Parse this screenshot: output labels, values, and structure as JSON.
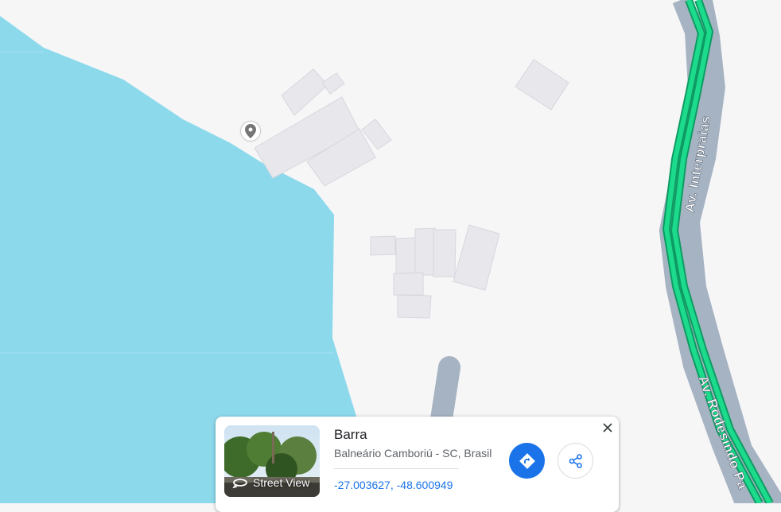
{
  "map": {
    "roads": [
      {
        "name": "Av. Interpraias"
      },
      {
        "name": "Av. Rodesindo Pa"
      }
    ],
    "colors": {
      "water": "#8dd9ec",
      "land": "#f7f6f7",
      "building": "#e8e8ec",
      "building_stroke": "#d5d7de",
      "road_casing": "#a6b3c2",
      "highway": "#1ddb8c",
      "highway_stroke": "#0e9b63"
    }
  },
  "marker": {
    "icon": "place-pin-icon"
  },
  "place_card": {
    "title": "Barra",
    "subtitle": "Balneário Camboriú - SC, Brasil",
    "coordinates": "-27.003627, -48.600949",
    "thumbnail_label": "Street View",
    "icons": {
      "thumbnail": "street-view-360-icon",
      "directions": "directions-icon",
      "share": "share-icon",
      "close": "close-icon"
    },
    "accent_color": "#1a73e8"
  }
}
